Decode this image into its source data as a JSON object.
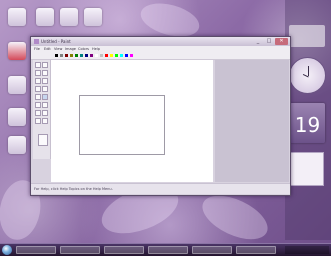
{
  "window": {
    "title": "Untitled - Paint",
    "menu": [
      "File",
      "Edit",
      "View",
      "Image",
      "Colors",
      "Help"
    ],
    "status": "For Help, click Help Topics on the Help Menu.",
    "coords": "",
    "size": ""
  },
  "palette": [
    "#000000",
    "#808080",
    "#800000",
    "#808000",
    "#008000",
    "#008080",
    "#000080",
    "#800080",
    "#ffffff",
    "#c0c0c0",
    "#ff0000",
    "#ffff00",
    "#00ff00",
    "#00ffff",
    "#0000ff",
    "#ff00ff"
  ],
  "canvas": {
    "selection_text": ""
  },
  "sidebar": {
    "calendar_day": "19",
    "calendar_month": "",
    "notes": [
      "",
      "",
      ""
    ]
  },
  "taskbar": {
    "time": ""
  },
  "icons": {
    "start": "windows-orb-icon",
    "clock": "clock-icon",
    "calendar": "calendar-icon"
  }
}
